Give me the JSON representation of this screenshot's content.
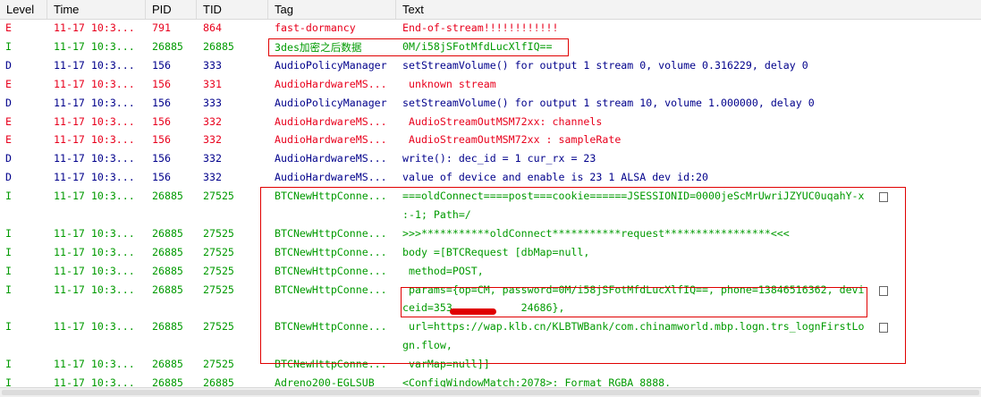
{
  "columns": [
    "Level",
    "Time",
    "PID",
    "TID",
    "Tag",
    "Text"
  ],
  "colors": {
    "E": "#e8001c",
    "I": "#009a00",
    "D": "#00008b"
  },
  "rows": [
    {
      "level": "E",
      "time": "11-17 10:3...",
      "pid": "791",
      "tid": "864",
      "tag": "fast-dormancy",
      "text": "End-of-stream!!!!!!!!!!!!"
    },
    {
      "level": "I",
      "time": "11-17 10:3...",
      "pid": "26885",
      "tid": "26885",
      "tag": "3des加密之后数据",
      "text": "0M/i58jSFotMfdLucXlfIQ=="
    },
    {
      "level": "D",
      "time": "11-17 10:3...",
      "pid": "156",
      "tid": "333",
      "tag": "AudioPolicyManager",
      "text": "setStreamVolume() for output 1 stream 0, volume 0.316229, delay 0"
    },
    {
      "level": "E",
      "time": "11-17 10:3...",
      "pid": "156",
      "tid": "331",
      "tag": "AudioHardwareMS...",
      "text": " unknown stream"
    },
    {
      "level": "D",
      "time": "11-17 10:3...",
      "pid": "156",
      "tid": "333",
      "tag": "AudioPolicyManager",
      "text": "setStreamVolume() for output 1 stream 10, volume 1.000000, delay 0"
    },
    {
      "level": "E",
      "time": "11-17 10:3...",
      "pid": "156",
      "tid": "332",
      "tag": "AudioHardwareMS...",
      "text": " AudioStreamOutMSM72xx: channels"
    },
    {
      "level": "E",
      "time": "11-17 10:3...",
      "pid": "156",
      "tid": "332",
      "tag": "AudioHardwareMS...",
      "text": " AudioStreamOutMSM72xx : sampleRate"
    },
    {
      "level": "D",
      "time": "11-17 10:3...",
      "pid": "156",
      "tid": "332",
      "tag": "AudioHardwareMS...",
      "text": "write(): dec_id = 1 cur_rx = 23"
    },
    {
      "level": "D",
      "time": "11-17 10:3...",
      "pid": "156",
      "tid": "332",
      "tag": "AudioHardwareMS...",
      "text": "value of device and enable is 23 1 ALSA dev id:20"
    },
    {
      "level": "I",
      "time": "11-17 10:3...",
      "pid": "26885",
      "tid": "27525",
      "tag": "BTCNewHttpConne...",
      "text": "===oldConnect====post===cookie======JSESSIONID=0000jeScMrUwriJZYUC0uqahY-x",
      "text2": ":-1; Path=/"
    },
    {
      "level": "I",
      "time": "11-17 10:3...",
      "pid": "26885",
      "tid": "27525",
      "tag": "BTCNewHttpConne...",
      "text": ">>>***********oldConnect***********request*****************<<<"
    },
    {
      "level": "I",
      "time": "11-17 10:3...",
      "pid": "26885",
      "tid": "27525",
      "tag": "BTCNewHttpConne...",
      "text": "body =[BTCRequest [dbMap=null,"
    },
    {
      "level": "I",
      "time": "11-17 10:3...",
      "pid": "26885",
      "tid": "27525",
      "tag": "BTCNewHttpConne...",
      "text": " method=POST,"
    },
    {
      "level": "I",
      "time": "11-17 10:3...",
      "pid": "26885",
      "tid": "27525",
      "tag": "BTCNewHttpConne...",
      "text": " params={op=CM, password=0M/i58jSFotMfdLucXlfIQ==, phone=13846516362, devi",
      "text2": "ceid=353           24686},"
    },
    {
      "level": "I",
      "time": "11-17 10:3...",
      "pid": "26885",
      "tid": "27525",
      "tag": "BTCNewHttpConne...",
      "text": " url=https://wap.klb.cn/KLBTWBank/com.chinamworld.mbp.logn.trs_lognFirstLo",
      "text2": "gn.flow,"
    },
    {
      "level": "I",
      "time": "11-17 10:3...",
      "pid": "26885",
      "tid": "27525",
      "tag": "BTCNewHttpConne...",
      "text": " varMap=null]]"
    },
    {
      "level": "I",
      "time": "11-17 10:3...",
      "pid": "26885",
      "tid": "26885",
      "tag": "Adreno200-EGLSUB",
      "text": "<ConfigWindowMatch:2078>: Format RGBA_8888."
    }
  ]
}
